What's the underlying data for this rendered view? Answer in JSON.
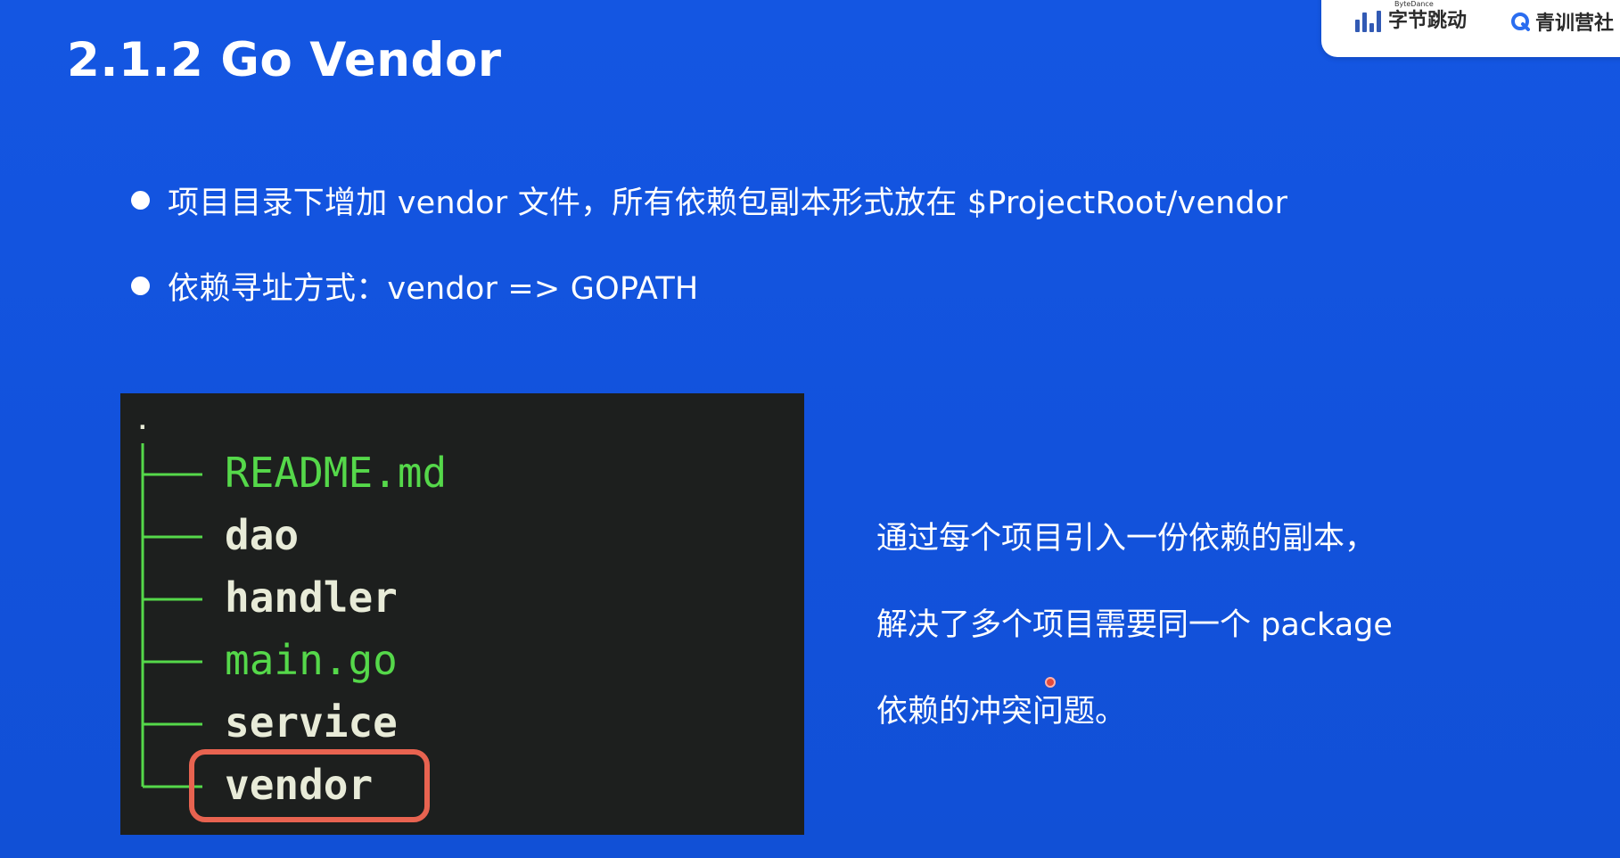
{
  "slide": {
    "title": "2.1.2 Go Vendor",
    "bullets": [
      "项目目录下增加 vendor 文件，所有依赖包副本形式放在 $ProjectRoot/vendor",
      "依赖寻址方式：vendor => GOPATH"
    ],
    "note_lines": [
      "通过每个项目引入一份依赖的副本，",
      "解决了多个项目需要同一个 package",
      "依赖的冲突问题。"
    ]
  },
  "branding": {
    "bytedance_small": "ByteDance",
    "bytedance_label": "字节跳动",
    "camp_label": "青训营社"
  },
  "file_tree": {
    "root": ".",
    "items": [
      {
        "name": "README.md",
        "kind": "file"
      },
      {
        "name": "dao",
        "kind": "dir"
      },
      {
        "name": "handler",
        "kind": "dir"
      },
      {
        "name": "main.go",
        "kind": "file"
      },
      {
        "name": "service",
        "kind": "dir"
      },
      {
        "name": "vendor",
        "kind": "dir",
        "highlighted": true
      }
    ]
  },
  "colors": {
    "background": "#1356e0",
    "terminal_bg": "#1d1f1e",
    "file_green": "#55d84a",
    "dir_text": "#e8ebd8",
    "highlight_red": "#e86350"
  }
}
